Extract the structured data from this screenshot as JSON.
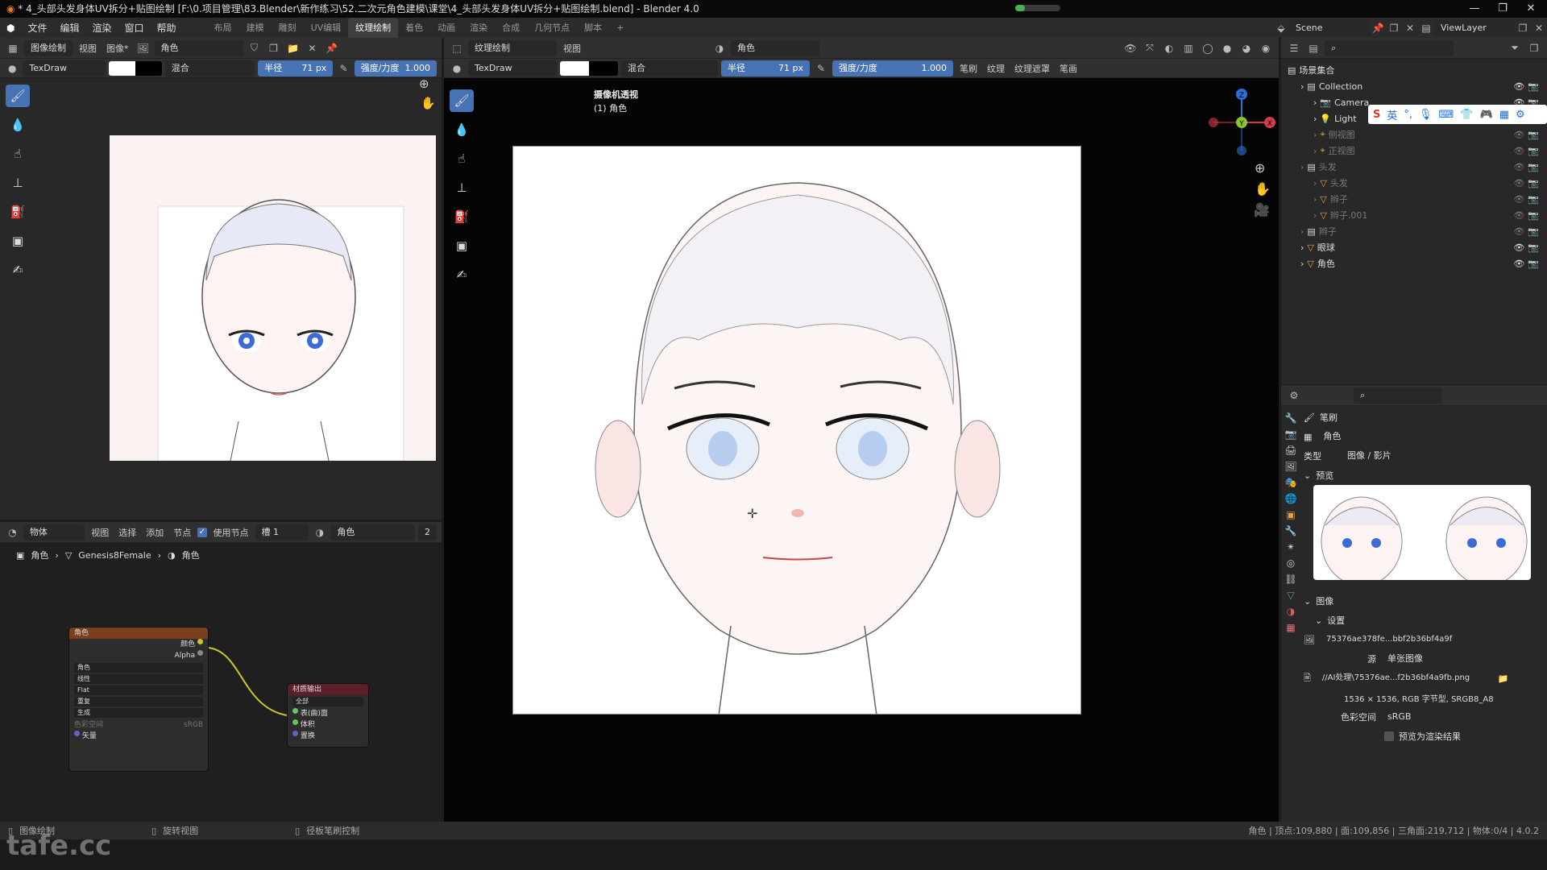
{
  "window": {
    "title": "* 4_头部头发身体UV拆分+贴图绘制 [F:\\0.项目管理\\83.Blender\\新作练习\\52.二次元角色建模\\课堂\\4_头部头发身体UV拆分+贴图绘制.blend] - Blender 4.0"
  },
  "menu": [
    "文件",
    "编辑",
    "渲染",
    "窗口",
    "帮助"
  ],
  "workspaces": [
    {
      "label": "布局"
    },
    {
      "label": "建模"
    },
    {
      "label": "雕刻"
    },
    {
      "label": "UV编辑"
    },
    {
      "label": "纹理绘制",
      "active": true
    },
    {
      "label": "着色"
    },
    {
      "label": "动画"
    },
    {
      "label": "渲染"
    },
    {
      "label": "合成"
    },
    {
      "label": "几何节点"
    },
    {
      "label": "脚本"
    }
  ],
  "scene_field": "Scene",
  "viewlayer_field": "ViewLayer",
  "image_editor": {
    "mode": "图像绘制",
    "menus": [
      "视图",
      "图像*"
    ],
    "image_name": "角色",
    "brush_name": "TexDraw",
    "blend": "混合",
    "radius_label": "半径",
    "radius_value": "71 px",
    "strength_label": "强度/力度",
    "strength_value": "1.000"
  },
  "viewport": {
    "mode": "纹理绘制",
    "view_menu": "视图",
    "material": "角色",
    "brush_name": "TexDraw",
    "blend": "混合",
    "radius_label": "半径",
    "radius_value": "71 px",
    "strength_label": "强度/力度",
    "strength_value": "1.000",
    "extra_menus": [
      "笔刷",
      "纹理",
      "纹理遮罩",
      "笔画"
    ],
    "overlay_title": "摄像机透视",
    "overlay_sub": "(1) 角色",
    "gizmo": {
      "z": "Z",
      "y": "Y",
      "x": "X"
    }
  },
  "node_editor": {
    "object_mode": "物体",
    "menus": [
      "视图",
      "选择",
      "添加",
      "节点"
    ],
    "use_nodes": "使用节点",
    "slot": "槽 1",
    "material": "角色",
    "users": "2",
    "breadcrumb": [
      "角色",
      "Genesis8Female",
      "角色"
    ],
    "tex_node": {
      "title": "角色",
      "out_color": "颜色",
      "out_alpha": "Alpha",
      "image": "角色",
      "interp": "线性",
      "proj": "Flat",
      "ext": "重复",
      "source": "生成",
      "colorspace_label": "色彩空间",
      "colorspace_value": "sRGB",
      "vector": "矢量"
    },
    "out_node": {
      "title": "材质输出",
      "target": "全部",
      "surface": "表(曲)面",
      "volume": "体积",
      "displacement": "置换"
    }
  },
  "outliner": {
    "root": "场景集合",
    "items": [
      {
        "label": "Collection",
        "level": 1,
        "type": "collection"
      },
      {
        "label": "Camera",
        "level": 2,
        "type": "camera"
      },
      {
        "label": "Light",
        "level": 2,
        "type": "light"
      },
      {
        "label": "侧视图",
        "level": 2,
        "type": "empty",
        "dim": true
      },
      {
        "label": "正视图",
        "level": 2,
        "type": "empty",
        "dim": true
      },
      {
        "label": "头发",
        "level": 1,
        "type": "collection",
        "dim": true
      },
      {
        "label": "头发",
        "level": 2,
        "type": "mesh",
        "dim": true
      },
      {
        "label": "辫子",
        "level": 2,
        "type": "mesh",
        "dim": true
      },
      {
        "label": "辫子.001",
        "level": 2,
        "type": "mesh",
        "dim": true
      },
      {
        "label": "辫子",
        "level": 1,
        "type": "collection",
        "dim": true
      },
      {
        "label": "眼球",
        "level": 1,
        "type": "mesh"
      },
      {
        "label": "角色",
        "level": 1,
        "type": "mesh"
      }
    ]
  },
  "properties": {
    "brush_label": "笔刷",
    "texture_name": "角色",
    "type_label": "类型",
    "type_value": "图像 / 影片",
    "preview_label": "预览",
    "image_label": "图像",
    "settings_label": "设置",
    "image_id": "75376ae378fe...bbf2b36bf4a9f",
    "source_label": "源",
    "source_value": "单张图像",
    "path": "//AI处理\\75376ae...f2b36bf4a9fb.png",
    "info": "1536 × 1536, RGB 字节型, SRGB8_A8",
    "colorspace_label": "色彩空间",
    "colorspace_value": "sRGB",
    "preview_check": "预览为渲染结果"
  },
  "statusbar": {
    "left": "图像绘制",
    "middle": "旋转视图",
    "right": "径板笔刷控制",
    "stats": "角色 | 顶点:109,880 | 面:109,856 | 三角面:219,712 | 物体:0/4 | 4.0.2"
  },
  "watermark": "tafe.cc",
  "ime": {
    "label": "英"
  }
}
